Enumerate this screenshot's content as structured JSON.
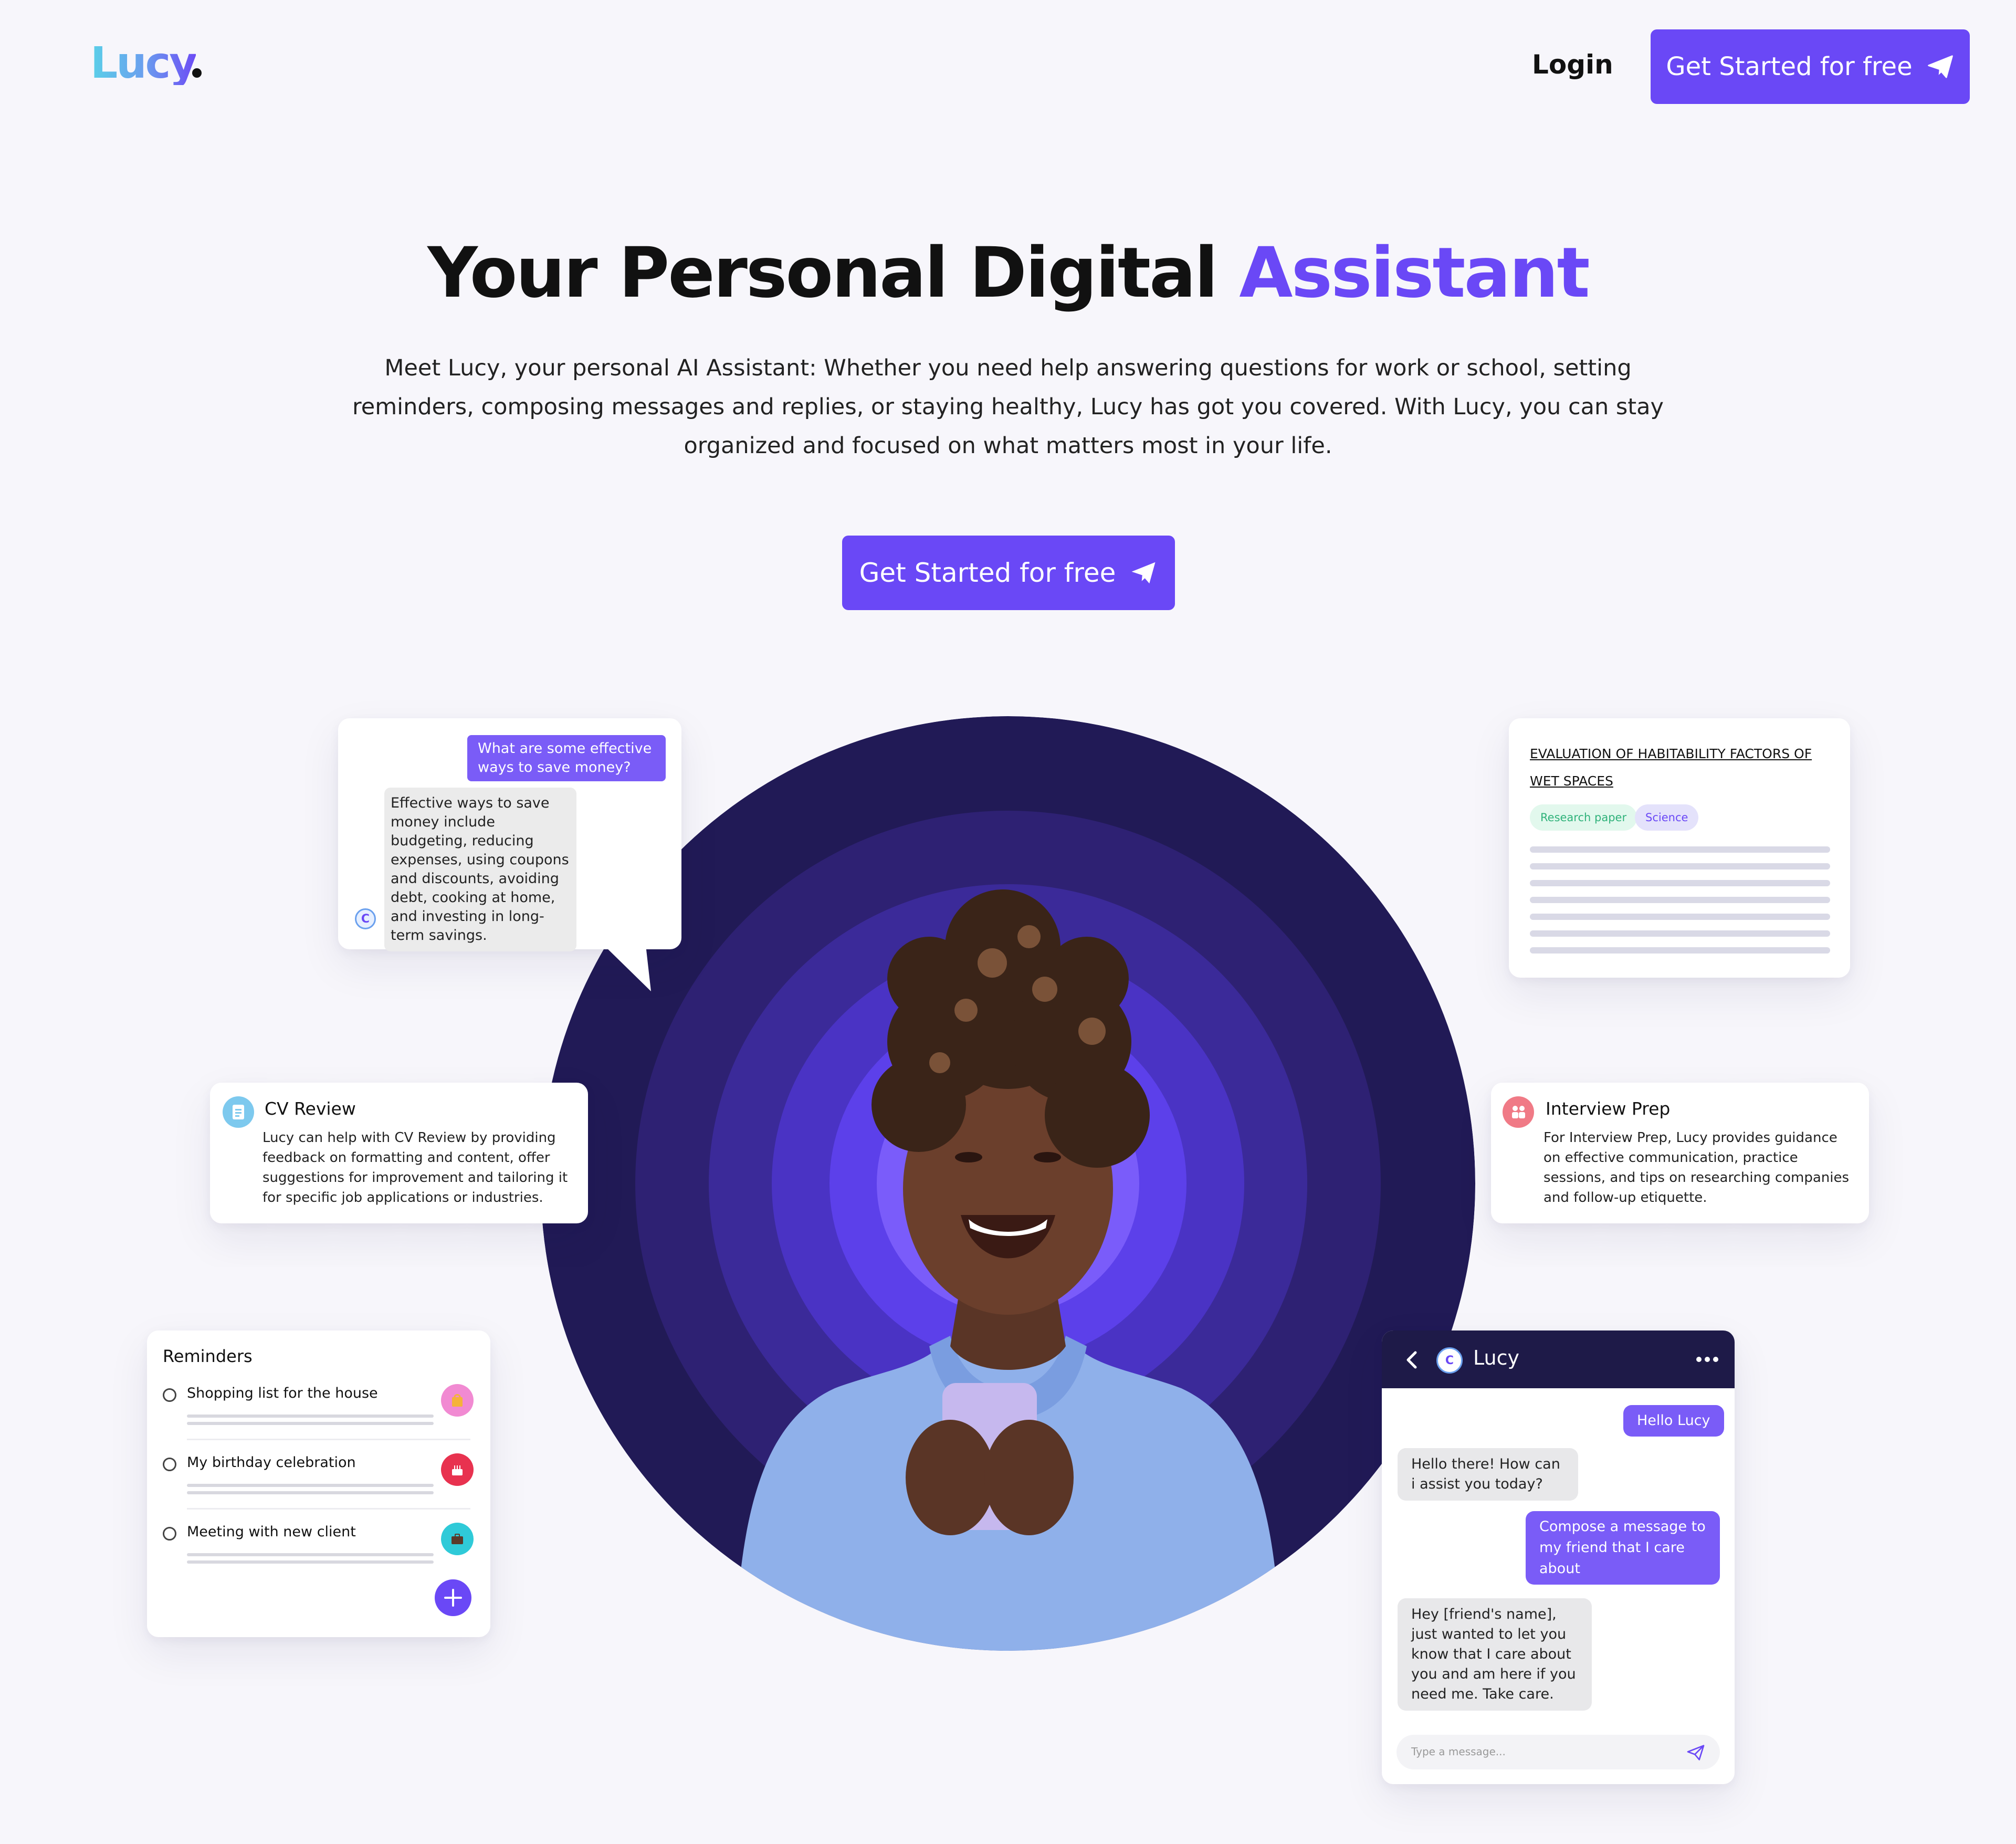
{
  "header": {
    "logo_text": "Lucy",
    "login_label": "Login",
    "cta_label": "Get Started for free"
  },
  "hero": {
    "title_main": "Your Personal Digital ",
    "title_accent": "Assistant",
    "description": "Meet Lucy, your personal AI Assistant: Whether you need help answering questions for work or school, setting reminders, composing messages and replies, or staying healthy, Lucy has got you covered. With Lucy, you can stay organized and focused on what matters most in your life.",
    "cta_label": "Get Started for free"
  },
  "qa_card": {
    "question": "What are some effective ways to save money?",
    "answer": "Effective ways to save money include budgeting, reducing expenses, using coupons and discounts, avoiding debt, cooking at home, and investing in long-term savings."
  },
  "paper_card": {
    "title": "EVALUATION OF HABITABILITY FACTORS OF WET SPACES",
    "tags": [
      "Research paper",
      "Science"
    ]
  },
  "cv_card": {
    "title": "CV Review",
    "text": "Lucy can help with CV Review by providing feedback on formatting and content, offer suggestions for improvement and tailoring it for specific job applications or industries."
  },
  "interview_card": {
    "title": "Interview Prep",
    "text": "For Interview Prep, Lucy provides guidance on effective communication, practice sessions, and tips on researching companies and follow-up etiquette."
  },
  "reminders": {
    "title": "Reminders",
    "items": [
      {
        "label": "Shopping list for the house",
        "icon": "shopping-bag-icon"
      },
      {
        "label": "My birthday celebration",
        "icon": "birthday-cake-icon"
      },
      {
        "label": "Meeting with new client",
        "icon": "briefcase-icon"
      }
    ]
  },
  "chat": {
    "title": "Lucy",
    "messages": [
      {
        "from": "user",
        "text": "Hello Lucy"
      },
      {
        "from": "bot",
        "text": "Hello there! How can i assist you today?"
      },
      {
        "from": "user",
        "text": "Compose a message to my friend that I care about"
      },
      {
        "from": "bot",
        "text": "Hey [friend's name], just wanted to let you know that I care about you and am here if you need me. Take care."
      }
    ],
    "input_placeholder": "Type a message..."
  },
  "colors": {
    "accent": "#6a48f6",
    "background": "#f7f6fb",
    "chat_header": "#1e1a48"
  }
}
